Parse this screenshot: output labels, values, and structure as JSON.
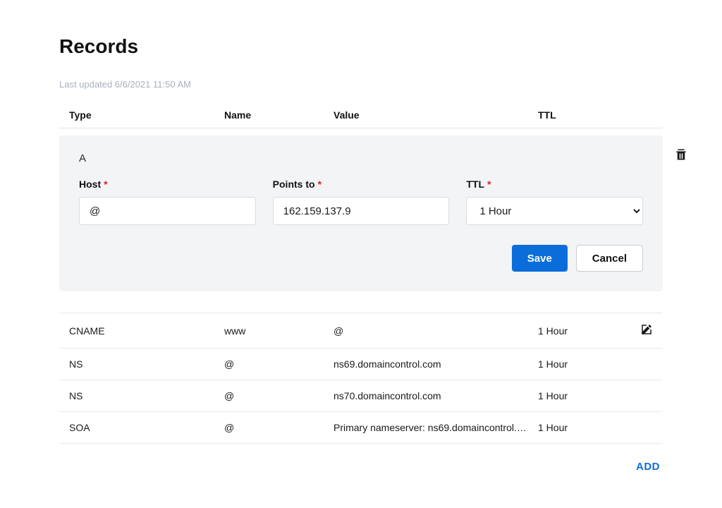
{
  "page": {
    "title": "Records",
    "last_updated": "Last updated 6/6/2021 11:50 AM"
  },
  "headers": {
    "type": "Type",
    "name": "Name",
    "value": "Value",
    "ttl": "TTL"
  },
  "edit_record": {
    "record_type": "A",
    "field_labels": {
      "host": "Host",
      "points_to": "Points to",
      "ttl": "TTL"
    },
    "values": {
      "host": "@",
      "points_to": "162.159.137.9",
      "ttl_selected": "1 Hour"
    },
    "ttl_options": [
      "1 Hour"
    ],
    "buttons": {
      "save": "Save",
      "cancel": "Cancel"
    }
  },
  "rows": [
    {
      "type": "CNAME",
      "name": "www",
      "value": "@",
      "ttl": "1 Hour",
      "editable": true
    },
    {
      "type": "NS",
      "name": "@",
      "value": "ns69.domaincontrol.com",
      "ttl": "1 Hour",
      "editable": false
    },
    {
      "type": "NS",
      "name": "@",
      "value": "ns70.domaincontrol.com",
      "ttl": "1 Hour",
      "editable": false
    },
    {
      "type": "SOA",
      "name": "@",
      "value": "Primary nameserver: ns69.domaincontrol.co…",
      "ttl": "1 Hour",
      "editable": false
    }
  ],
  "add_label": "ADD"
}
